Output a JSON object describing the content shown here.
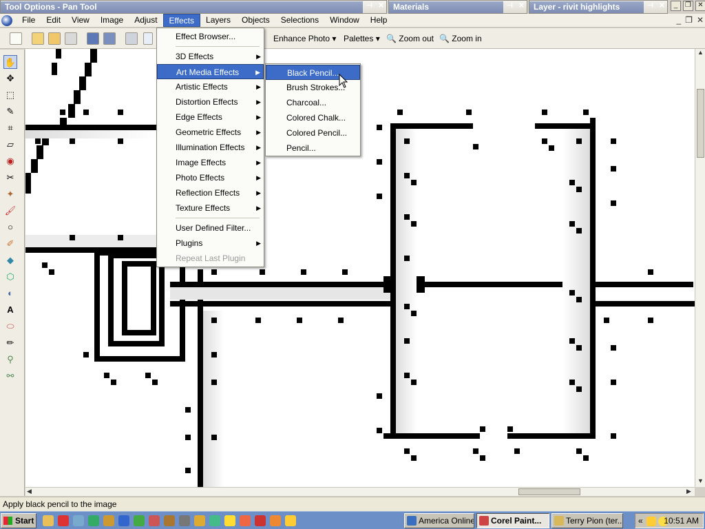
{
  "palettes": {
    "tool_options": "Tool Options - Pan Tool",
    "materials": "Materials",
    "layer": "Layer - rivit highlights"
  },
  "menubar": {
    "items": [
      "File",
      "Edit",
      "View",
      "Image",
      "Adjust",
      "Effects",
      "Layers",
      "Objects",
      "Selections",
      "Window",
      "Help"
    ],
    "active": "Effects"
  },
  "toolbar": {
    "enhance_photo": "Enhance Photo",
    "palettes": "Palettes",
    "zoom_out": "Zoom out",
    "zoom_in": "Zoom in"
  },
  "effects_menu": {
    "effect_browser": "Effect Browser...",
    "items": [
      "3D Effects",
      "Art Media Effects",
      "Artistic Effects",
      "Distortion Effects",
      "Edge Effects",
      "Geometric Effects",
      "Illumination Effects",
      "Image Effects",
      "Photo Effects",
      "Reflection Effects",
      "Texture Effects"
    ],
    "highlighted": "Art Media Effects",
    "user_defined_filter": "User Defined Filter...",
    "plugins": "Plugins",
    "repeat_last_plugin": "Repeat Last Plugin"
  },
  "art_media_submenu": {
    "items": [
      "Black Pencil...",
      "Brush Strokes...",
      "Charcoal...",
      "Colored Chalk...",
      "Colored Pencil...",
      "Pencil..."
    ],
    "highlighted": "Black Pencil..."
  },
  "status_bar": {
    "text": "Apply black pencil to the image"
  },
  "taskbar": {
    "start": "Start",
    "tasks": [
      "America Online",
      "Corel Paint...",
      "Terry Pion (ter..."
    ],
    "active_task": "Corel Paint...",
    "tray_chevron": "«",
    "clock": "10:51 AM"
  },
  "colors": {
    "menu_highlight": "#3c6cc7",
    "taskbar": "#6b8fc6"
  }
}
